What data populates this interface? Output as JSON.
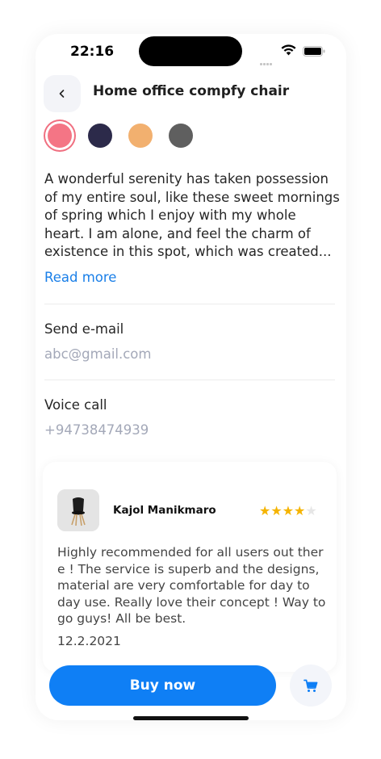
{
  "status_bar": {
    "time": "22:16"
  },
  "header": {
    "title": "Home office compfy chair",
    "back_icon": "chevron-left-icon"
  },
  "colors": {
    "swatches": [
      "#f47585",
      "#2c2a4a",
      "#f2b06f",
      "#5f5f5f"
    ],
    "selected_index": 0,
    "accent": "#0f7ff5",
    "link": "#1a7fe8",
    "star": "#f5b400"
  },
  "description": {
    "text": "A wonderful serenity has taken possession of my entire soul, like these sweet mornings of spring which I enjoy with my whole heart. I am alone, and feel the charm of existence in this spot, which was created...",
    "read_more": "Read more"
  },
  "contact": {
    "email_label": "Send e-mail",
    "email_value": "abc@gmail.com",
    "phone_label": "Voice call",
    "phone_value": "+94738474939"
  },
  "review": {
    "reviewer": "Kajol Manikmaro",
    "rating": 4,
    "max_rating": 5,
    "text": "Highly recommended for all users out ther e ! The service is superb and the designs, material are very comfortable for day to day use. Really love their concept ! Way to go guys! All be best.",
    "date": "12.2.2021"
  },
  "actions": {
    "buy_label": "Buy now",
    "cart_icon": "cart-icon"
  }
}
